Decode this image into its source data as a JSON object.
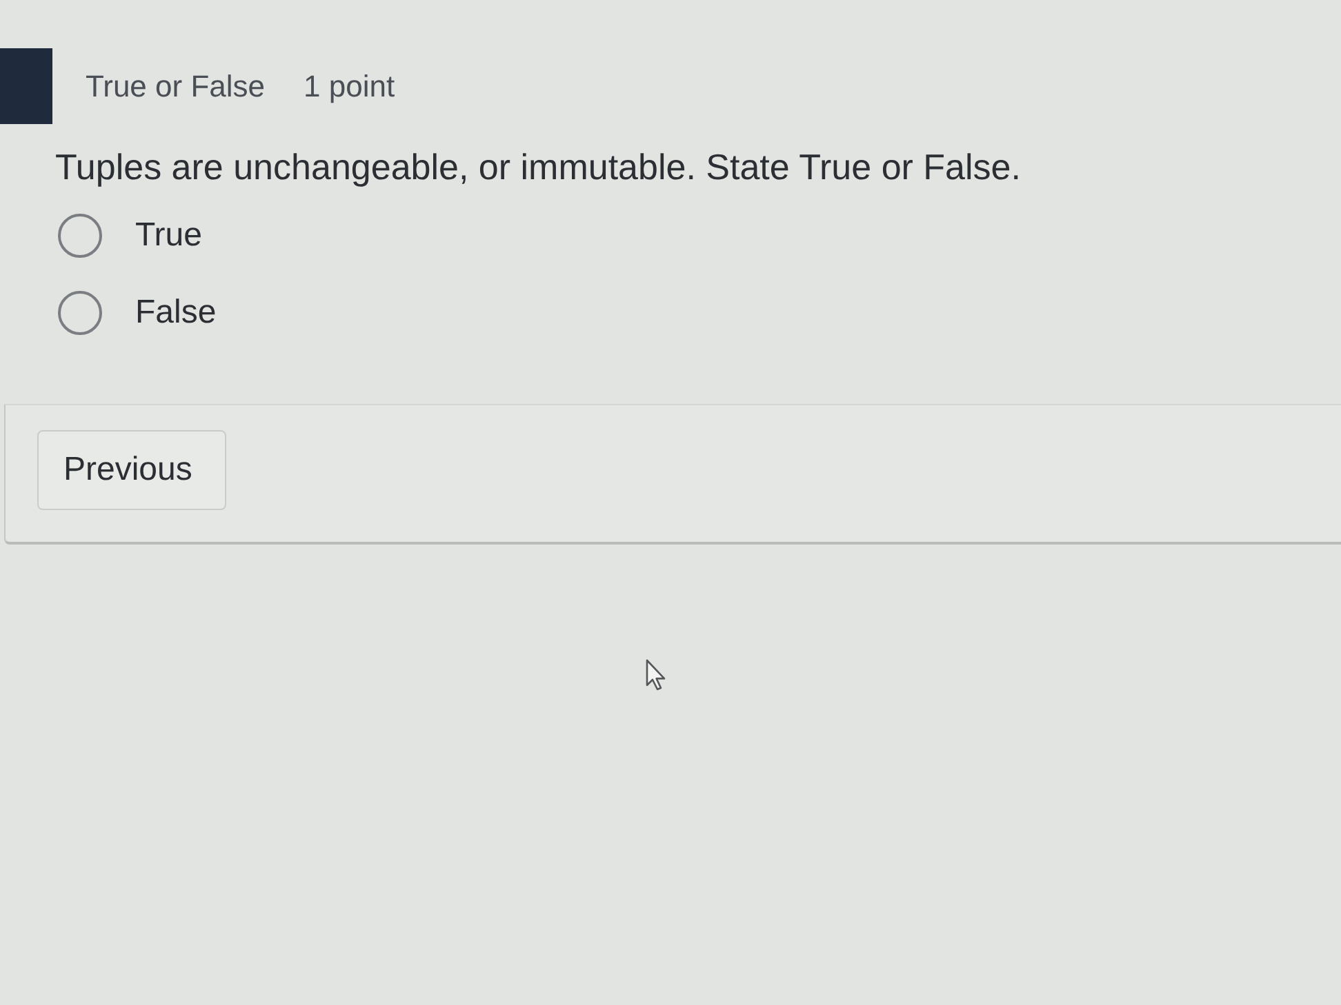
{
  "question_header": {
    "title": "True or False",
    "points": "1 point"
  },
  "question": {
    "text": "Tuples are unchangeable, or immutable. State True or False.",
    "options": [
      {
        "label": "True",
        "selected": false
      },
      {
        "label": "False",
        "selected": false
      }
    ]
  },
  "footer": {
    "buttons": [
      {
        "label": "Previous"
      }
    ]
  }
}
